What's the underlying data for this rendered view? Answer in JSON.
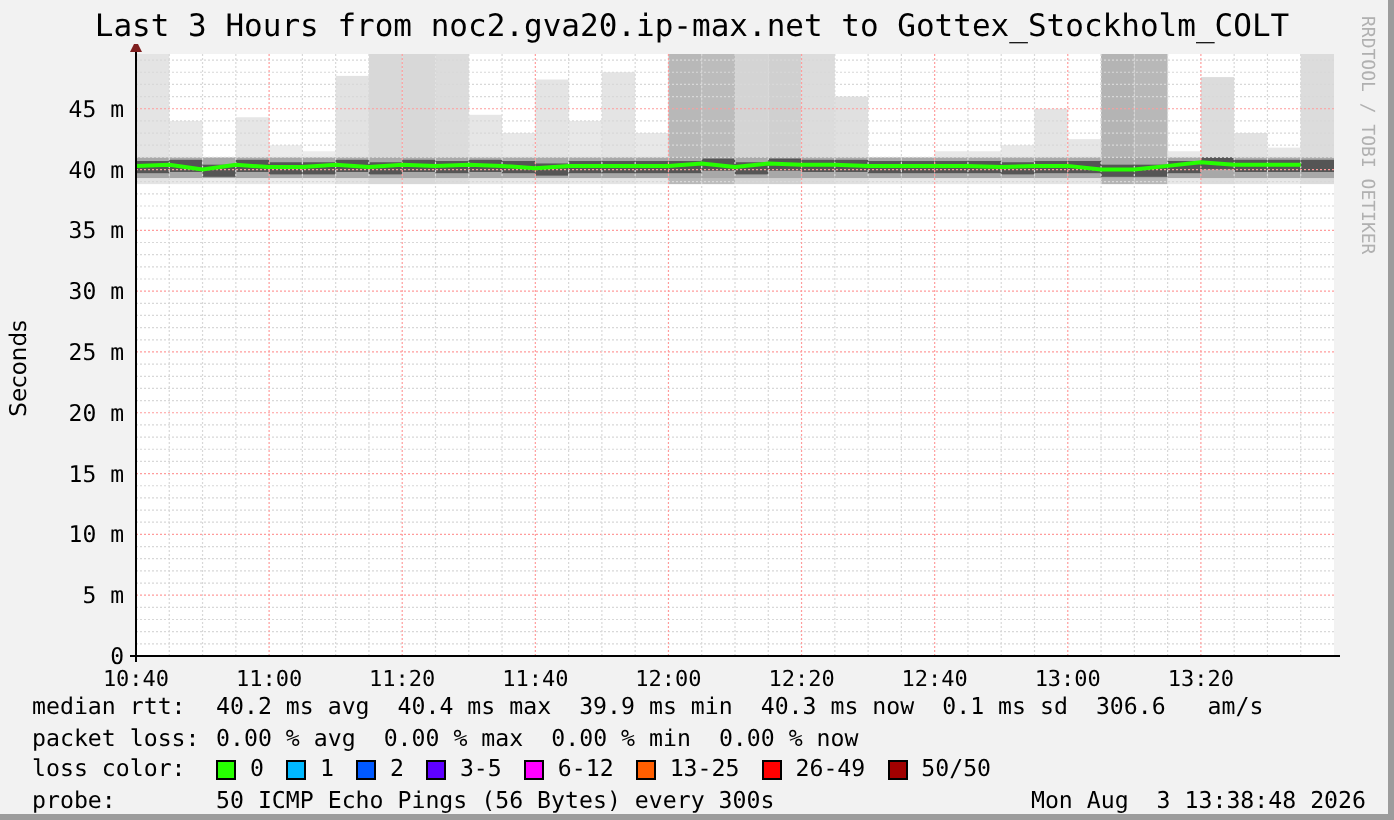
{
  "title": "Last 3 Hours from noc2.gva20.ip-max.net to Gottex_Stockholm_COLT",
  "side_credit": "RRDTOOL / TOBI OETIKER",
  "chart": {
    "chart_data": {
      "type": "line",
      "ylabel": "Seconds",
      "categories": [
        "10:40",
        null,
        null,
        null,
        "11:00",
        null,
        null,
        null,
        "11:20",
        null,
        null,
        null,
        "11:40",
        null,
        null,
        null,
        "12:00",
        null,
        null,
        null,
        "12:20",
        null,
        null,
        null,
        "12:40",
        null,
        null,
        null,
        "13:00",
        null,
        null,
        null,
        "13:20",
        null,
        null,
        null
      ],
      "series": [
        {
          "color": "#26ff00",
          "values": [
            40.3,
            40.4,
            40.0,
            40.4,
            40.2,
            40.2,
            40.4,
            40.2,
            40.4,
            40.3,
            40.4,
            40.3,
            40.1,
            40.3,
            40.3,
            40.3,
            40.3,
            40.5,
            40.2,
            40.5,
            40.4,
            40.4,
            40.3,
            40.3,
            40.3,
            40.3,
            40.2,
            40.3,
            40.3,
            40.0,
            40.0,
            40.3,
            40.6,
            40.4,
            40.4,
            40.4
          ]
        }
      ],
      "ylim": [
        0,
        49.5
      ],
      "grid": true,
      "yticks": [
        {
          "value": 0,
          "label": "0"
        },
        {
          "value": 5,
          "label": "5 m"
        },
        {
          "value": 10,
          "label": "10 m"
        },
        {
          "value": 15,
          "label": "15 m"
        },
        {
          "value": 20,
          "label": "20 m"
        },
        {
          "value": 25,
          "label": "25 m"
        },
        {
          "value": 30,
          "label": "30 m"
        },
        {
          "value": 35,
          "label": "35 m"
        },
        {
          "value": 40,
          "label": "40 m"
        },
        {
          "value": 45,
          "label": "45 m"
        }
      ]
    }
  },
  "median_rtt": {
    "label": "median rtt:",
    "values": [
      "40.2 ms avg",
      "40.4 ms max",
      "39.9 ms min",
      "40.3 ms now",
      "0.1 ms sd",
      "306.6   am/s"
    ]
  },
  "packet_loss": {
    "label": "packet loss:",
    "values": [
      "0.00 % avg",
      "0.00 % max",
      "0.00 % min",
      "0.00 % now"
    ]
  },
  "loss_color": {
    "label": "loss color:",
    "items": [
      {
        "label": "0",
        "color": "#26ff00"
      },
      {
        "label": "1",
        "color": "#00b8ff"
      },
      {
        "label": "2",
        "color": "#0059ff"
      },
      {
        "label": "3-5",
        "color": "#5e00ff"
      },
      {
        "label": "6-12",
        "color": "#ff00ff"
      },
      {
        "label": "13-25",
        "color": "#ff5e00"
      },
      {
        "label": "26-49",
        "color": "#ff0000"
      },
      {
        "label": "50/50",
        "color": "#a10000"
      }
    ]
  },
  "probe": {
    "label": "probe:",
    "value": "50 ICMP Echo Pings (56 Bytes) every 300s",
    "timestamp": "Mon Aug  3 13:38:48 2026"
  }
}
